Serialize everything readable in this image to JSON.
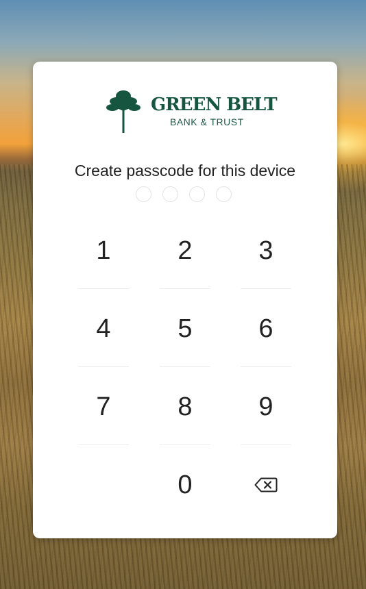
{
  "brand": {
    "name": "GREEN BELT",
    "subtitle": "BANK & TRUST",
    "color": "#16553f"
  },
  "prompt": {
    "text": "Create passcode for this device"
  },
  "passcode": {
    "length": 4,
    "entered": 0
  },
  "keypad": {
    "keys": [
      "1",
      "2",
      "3",
      "4",
      "5",
      "6",
      "7",
      "8",
      "9",
      "0"
    ],
    "delete_icon": "backspace-icon"
  }
}
